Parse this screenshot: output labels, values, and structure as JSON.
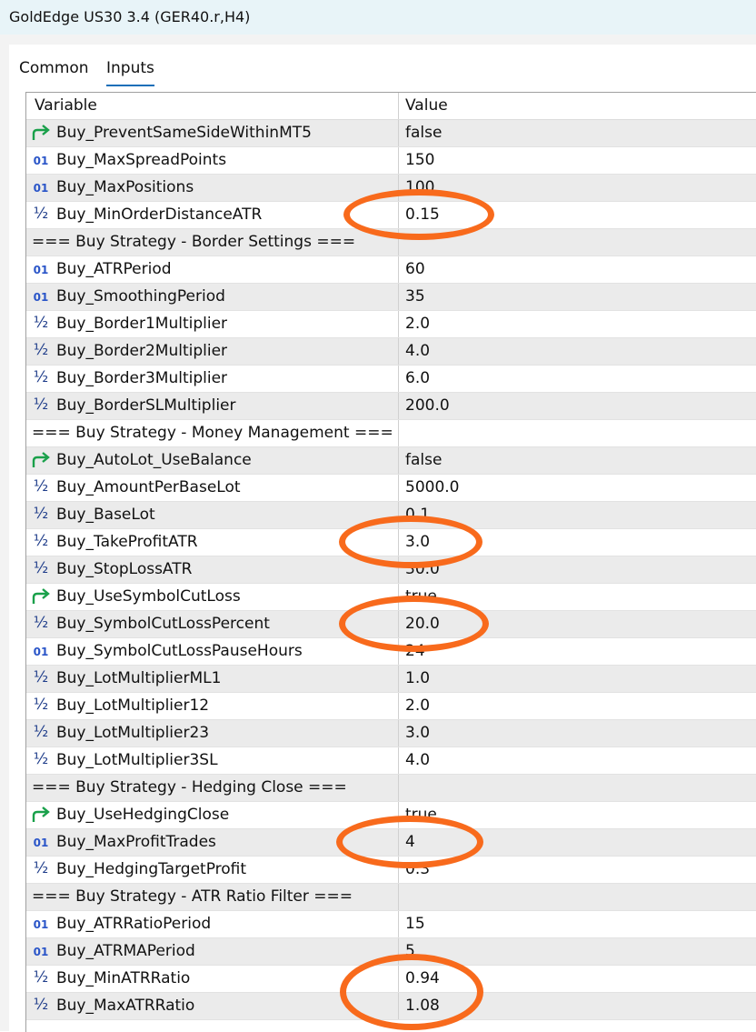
{
  "window": {
    "title": "GoldEdge US30 3.4 (GER40.r,H4)"
  },
  "tabs": [
    {
      "label": "Common"
    },
    {
      "label": "Inputs"
    }
  ],
  "table": {
    "columns": [
      "Variable",
      "Value"
    ],
    "rows": [
      {
        "icon": "bool",
        "name": "Buy_PreventSameSideWithinMT5",
        "value": "false"
      },
      {
        "icon": "int",
        "name": "Buy_MaxSpreadPoints",
        "value": "150"
      },
      {
        "icon": "int",
        "name": "Buy_MaxPositions",
        "value": "100"
      },
      {
        "icon": "double",
        "name": "Buy_MinOrderDistanceATR",
        "value": "0.15"
      },
      {
        "icon": "section",
        "name": "=== Buy Strategy - Border Settings ===",
        "value": ""
      },
      {
        "icon": "int",
        "name": "Buy_ATRPeriod",
        "value": "60"
      },
      {
        "icon": "int",
        "name": "Buy_SmoothingPeriod",
        "value": "35"
      },
      {
        "icon": "double",
        "name": "Buy_Border1Multiplier",
        "value": "2.0"
      },
      {
        "icon": "double",
        "name": "Buy_Border2Multiplier",
        "value": "4.0"
      },
      {
        "icon": "double",
        "name": "Buy_Border3Multiplier",
        "value": "6.0"
      },
      {
        "icon": "double",
        "name": "Buy_BorderSLMultiplier",
        "value": "200.0"
      },
      {
        "icon": "section",
        "name": "=== Buy Strategy - Money Management ===",
        "value": ""
      },
      {
        "icon": "bool",
        "name": "Buy_AutoLot_UseBalance",
        "value": "false"
      },
      {
        "icon": "double",
        "name": "Buy_AmountPerBaseLot",
        "value": "5000.0"
      },
      {
        "icon": "double",
        "name": "Buy_BaseLot",
        "value": "0.1"
      },
      {
        "icon": "double",
        "name": "Buy_TakeProfitATR",
        "value": "3.0"
      },
      {
        "icon": "double",
        "name": "Buy_StopLossATR",
        "value": "30.0"
      },
      {
        "icon": "bool",
        "name": "Buy_UseSymbolCutLoss",
        "value": "true"
      },
      {
        "icon": "double",
        "name": "Buy_SymbolCutLossPercent",
        "value": "20.0"
      },
      {
        "icon": "int",
        "name": "Buy_SymbolCutLossPauseHours",
        "value": "24"
      },
      {
        "icon": "double",
        "name": "Buy_LotMultiplierML1",
        "value": "1.0"
      },
      {
        "icon": "double",
        "name": "Buy_LotMultiplier12",
        "value": "2.0"
      },
      {
        "icon": "double",
        "name": "Buy_LotMultiplier23",
        "value": "3.0"
      },
      {
        "icon": "double",
        "name": "Buy_LotMultiplier3SL",
        "value": "4.0"
      },
      {
        "icon": "section",
        "name": "=== Buy Strategy - Hedging Close ===",
        "value": ""
      },
      {
        "icon": "bool",
        "name": "Buy_UseHedgingClose",
        "value": "true"
      },
      {
        "icon": "int",
        "name": "Buy_MaxProfitTrades",
        "value": "4"
      },
      {
        "icon": "double",
        "name": "Buy_HedgingTargetProfit",
        "value": "0.3"
      },
      {
        "icon": "section",
        "name": "=== Buy Strategy - ATR Ratio Filter ===",
        "value": ""
      },
      {
        "icon": "int",
        "name": "Buy_ATRRatioPeriod",
        "value": "15"
      },
      {
        "icon": "int",
        "name": "Buy_ATRMAPeriod",
        "value": "5"
      },
      {
        "icon": "double",
        "name": "Buy_MinATRRatio",
        "value": "0.94"
      },
      {
        "icon": "double",
        "name": "Buy_MaxATRRatio",
        "value": "1.08"
      }
    ]
  },
  "icons": {
    "int": {
      "glyph": "01",
      "name": "integer-type-icon"
    },
    "double": {
      "glyph": "½",
      "name": "double-type-icon"
    },
    "bool": {
      "glyph": "↱",
      "name": "bool-type-icon"
    }
  },
  "colors": {
    "highlight_ellipse": "#f86a1c",
    "row_alt": "#ebebeb",
    "tab_accent": "#1a6fb8"
  },
  "highlight_marks": [
    {
      "row": "Buy_MinOrderDistanceATR"
    },
    {
      "row": "Buy_TakeProfitATR"
    },
    {
      "row": "Buy_SymbolCutLossPercent"
    },
    {
      "row": "Buy_MaxProfitTrades"
    },
    {
      "row": "Buy_MinATRRatio"
    },
    {
      "row": "Buy_MaxATRRatio"
    }
  ]
}
